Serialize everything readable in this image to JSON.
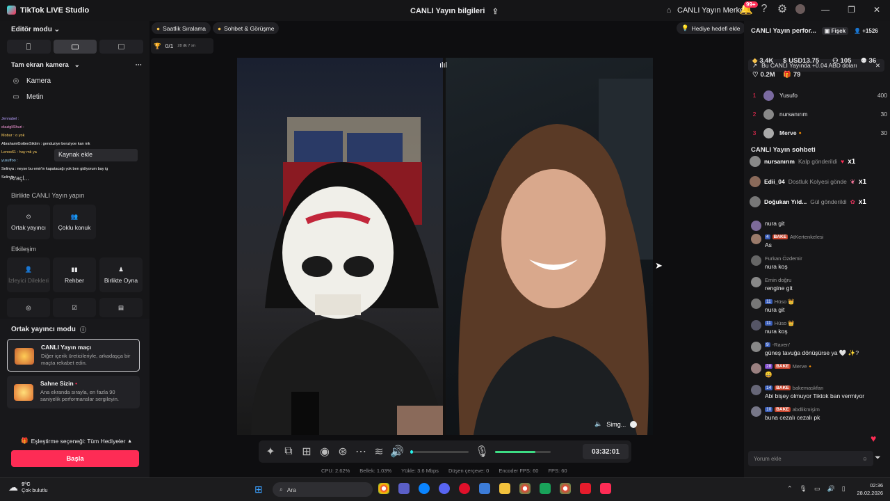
{
  "titlebar": {
    "app": "TikTok LIVE Studio",
    "center": "CANLI Yayın bilgileri",
    "live_center": "CANLI Yayın Merkezi",
    "notif_badge": "99+"
  },
  "left": {
    "editor_mode": "Editör modu",
    "scene_title": "Tam ekran kamera",
    "sources": [
      "Kamera",
      "Metin"
    ],
    "chat_overlay": [
      "Jennabel : ",
      "elazigliShuri : ",
      "Mobur : o yok",
      "AbrahamiGottenSiktim : genduziye benziyoe kan mk",
      "Lenos61 : hay mk ya",
      "yusuffoo : ",
      "Selinya : neyse bu emir'in kapatacağı yok ben gidiyorum bay ig",
      "Selinya : "
    ],
    "add_source": "Kaynak ekle",
    "tools": "Araçl...",
    "together_title": "Birlikte CANLI Yayın yapın",
    "together_btns": [
      "Ortak yayıncı",
      "Çoklu konuk"
    ],
    "interaction_title": "Etkileşim",
    "interaction_btns": [
      "İzleyici Dilekleri",
      "Rehber",
      "Birlikte Oyna"
    ],
    "cohost_title": "Ortak yayıncı modu",
    "cards": [
      {
        "title": "CANLI Yayın maçı",
        "desc": "Diğer içerik üreticileriyle, arkadaşça bir maçta rekabet edin."
      },
      {
        "title": "Sahne Sizin",
        "desc": "Ana ekranda sırayla, en fazla 90 saniyelik performanslar sergileyin."
      }
    ],
    "match_option": "Eşleştirme seçeneği: Tüm Hediyeler",
    "start": "Başla"
  },
  "center": {
    "chips": [
      "Saatlik Sıralama",
      "Sohbet & Görüşme"
    ],
    "gift_goal": "Hediye hedefi ekle",
    "ranking_value": "0/1",
    "ranking_time": "28 dk 7 sn",
    "simge": "Simg...",
    "timer": "03:32:01",
    "volume_level": 0.72,
    "stats": [
      "CPU: 2.62%",
      "Bellek: 1.03%",
      "Yükle: 3.6 Mbps",
      "Düşen çerçeve: 0",
      "Encoder FPS: 60",
      "FPS: 60"
    ]
  },
  "right": {
    "title": "CANLI Yayın perfor...",
    "fisek": "Fişek",
    "viewers": "+1526",
    "banner": "Bu CANLI Yayında +0.04 ABD doları",
    "kpis": {
      "coins": "3.4K",
      "usd": "USD13.75",
      "gifters": "105",
      "members": "36",
      "likes": "0.2M",
      "gifts": "79"
    },
    "leaderboard": [
      {
        "rank": "1",
        "name": "Yusufo",
        "score": "400"
      },
      {
        "rank": "2",
        "name": "nursanırım",
        "score": "30"
      },
      {
        "rank": "3",
        "name": "Merve🔸",
        "score": "30"
      }
    ],
    "chat_title": "CANLI Yayın sohbeti",
    "gifts": [
      {
        "name": "nursanırım",
        "action": "Kalp gönderildi",
        "mul": "x1"
      },
      {
        "name": "Edii_04",
        "action": "Dostluk Kolyesi gönde",
        "mul": "x1"
      },
      {
        "name": "Doğukan Yıld...",
        "action": "Gül gönderildi",
        "mul": "x1"
      }
    ],
    "messages": [
      {
        "lvl": "",
        "bake": false,
        "user": "",
        "text": "nura git"
      },
      {
        "lvl": "4",
        "bake": true,
        "user": "AtKertenkelesi",
        "text": "As"
      },
      {
        "lvl": "",
        "bake": false,
        "user": "Furkan Özdemir",
        "text": "nura koş"
      },
      {
        "lvl": "",
        "bake": false,
        "user": "Emin doğru",
        "text": "rengine git"
      },
      {
        "lvl": "11",
        "bake": false,
        "user": "Hüso 👑",
        "text": "nura git"
      },
      {
        "lvl": "11",
        "bake": false,
        "user": "Hüso 👑",
        "text": "nura koş"
      },
      {
        "lvl": "9",
        "bake": false,
        "user": "-Raven'",
        "text": "güneş tavuğa dönüşürse ya 🤍 ✨?"
      },
      {
        "lvl": "28",
        "bake": true,
        "user": "Merve🔸",
        "text": "😄"
      },
      {
        "lvl": "14",
        "bake": true,
        "user": "bakemaskfan",
        "text": "Abi bişey olmuyor Tiktok ban vermiyor"
      },
      {
        "lvl": "10",
        "bake": true,
        "user": "abdlikmişim",
        "text": "buna cezalı cezalı pk"
      }
    ],
    "comment_placeholder": "Yorum ekle"
  },
  "taskbar": {
    "temp": "9°C",
    "weather": "Çok bulutlu",
    "search": "Ara",
    "time": "02:36",
    "date": "28.02.2026"
  },
  "colors": {
    "accent": "#fe2c55",
    "teal": "#25f4ee"
  }
}
